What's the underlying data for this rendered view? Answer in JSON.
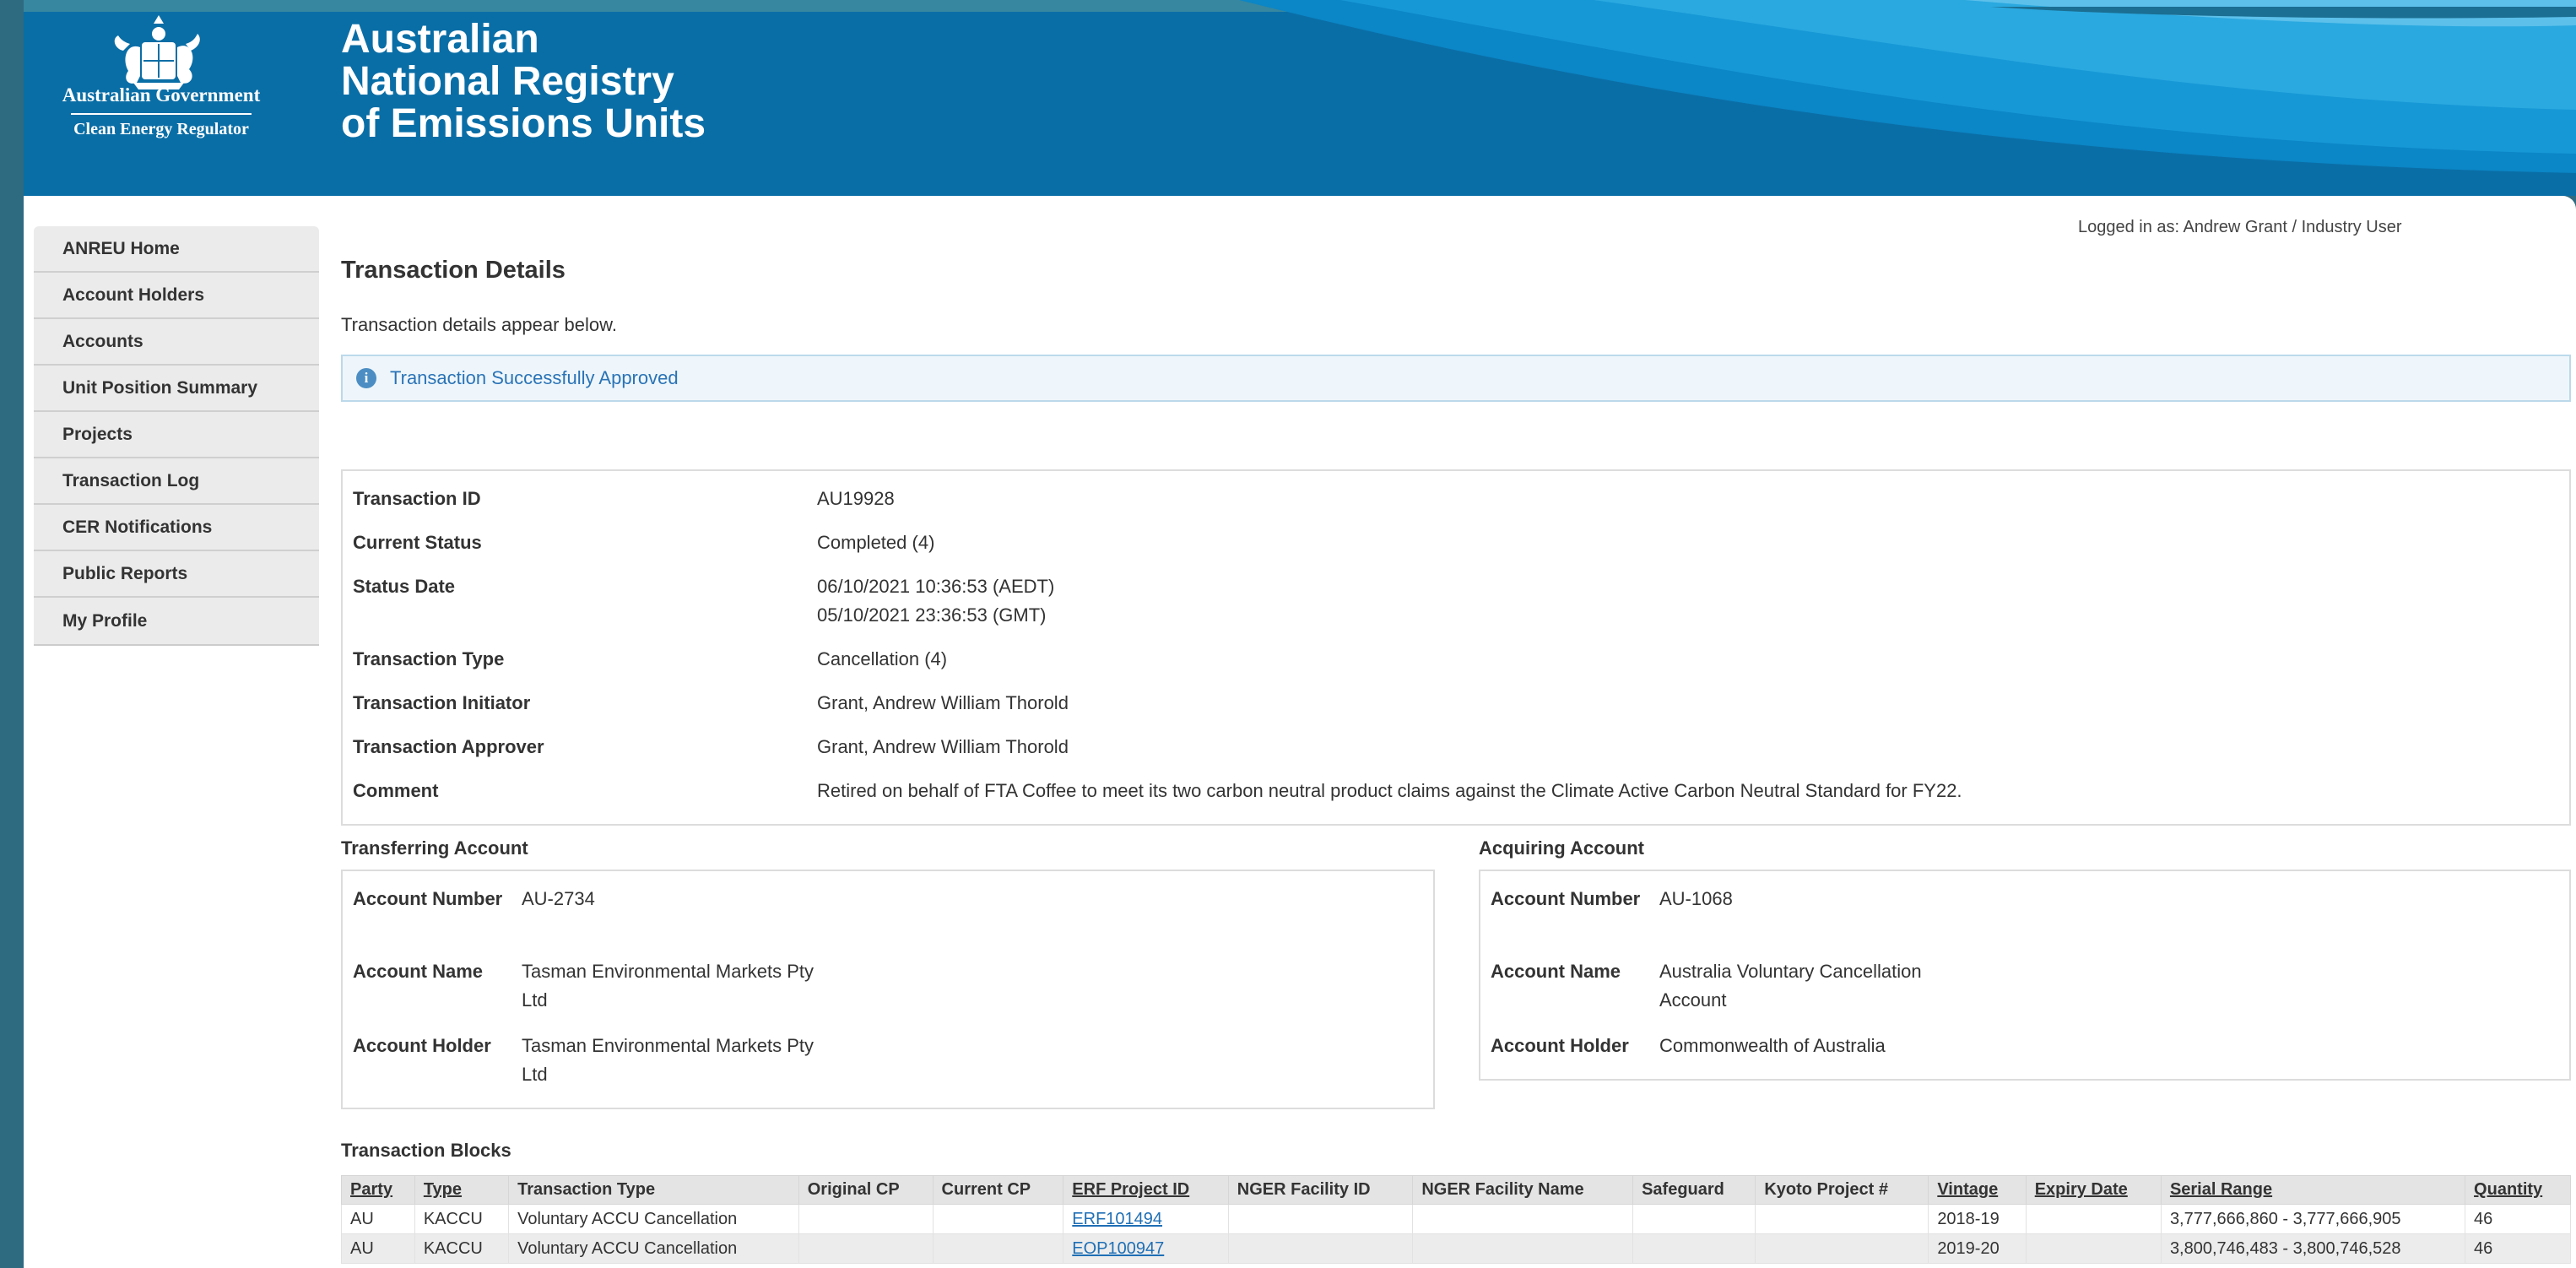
{
  "header": {
    "gov_line1": "Australian Government",
    "gov_line2": "Clean Energy Regulator",
    "title_lines": [
      "Australian",
      "National Registry",
      "of Emissions Units"
    ]
  },
  "user": {
    "logged_in": "Logged in as:  Andrew Grant / Industry User"
  },
  "sidebar": {
    "items": [
      {
        "label": "ANREU Home"
      },
      {
        "label": "Account Holders"
      },
      {
        "label": "Accounts"
      },
      {
        "label": "Unit Position Summary"
      },
      {
        "label": "Projects"
      },
      {
        "label": "Transaction Log"
      },
      {
        "label": "CER Notifications"
      },
      {
        "label": "Public Reports"
      },
      {
        "label": "My Profile"
      }
    ]
  },
  "main": {
    "title": "Transaction Details",
    "description": "Transaction details appear below.",
    "alert": {
      "icon": "info-icon",
      "text": "Transaction Successfully Approved",
      "color": "#2a73b6"
    }
  },
  "details": {
    "rows": [
      {
        "label": "Transaction ID",
        "value": "AU19928"
      },
      {
        "label": "Current Status",
        "value": "Completed (4)"
      },
      {
        "label": "Status Date",
        "value": "06/10/2021 10:36:53 (AEDT)",
        "value2": "05/10/2021 23:36:53 (GMT)"
      },
      {
        "label": "Transaction Type",
        "value": "Cancellation (4)"
      },
      {
        "label": "Transaction Initiator",
        "value": "Grant, Andrew William Thorold"
      },
      {
        "label": "Transaction Approver",
        "value": "Grant, Andrew William Thorold"
      },
      {
        "label": "Comment",
        "value": "Retired on behalf of FTA Coffee to meet its two carbon neutral product claims against the Climate Active Carbon Neutral Standard for FY22."
      }
    ]
  },
  "transferring": {
    "title": "Transferring Account",
    "number_label": "Account Number",
    "number": "AU-2734",
    "name_label": "Account Name",
    "name": "Tasman Environmental Markets Pty Ltd",
    "holder_label": "Account Holder",
    "holder": "Tasman Environmental Markets Pty Ltd"
  },
  "acquiring": {
    "title": "Acquiring Account",
    "number_label": "Account Number",
    "number": "AU-1068",
    "name_label": "Account Name",
    "name": "Australia Voluntary Cancellation Account",
    "holder_label": "Account Holder",
    "holder": "Commonwealth of Australia"
  },
  "blocks": {
    "title": "Transaction Blocks",
    "headers": [
      "Party",
      "Type",
      "Transaction Type",
      "Original CP",
      "Current CP",
      "ERF Project ID",
      "NGER Facility ID",
      "NGER Facility Name",
      "Safeguard",
      "Kyoto Project #",
      "Vintage",
      "Expiry Date",
      "Serial Range",
      "Quantity"
    ],
    "rows": [
      [
        "AU",
        "KACCU",
        "Voluntary ACCU Cancellation",
        "",
        "",
        "ERF101494",
        "",
        "",
        "",
        "",
        "2018-19",
        "",
        "3,777,666,860 - 3,777,666,905",
        "46"
      ],
      [
        "AU",
        "KACCU",
        "Voluntary ACCU Cancellation",
        "",
        "",
        "EOP100947",
        "",
        "",
        "",
        "",
        "2019-20",
        "",
        "3,800,746,483 - 3,800,746,528",
        "46"
      ]
    ]
  },
  "colors": {
    "banner": "#0a6ea6",
    "link": "#1f6fb5",
    "alert_bg": "#eef6fb"
  }
}
